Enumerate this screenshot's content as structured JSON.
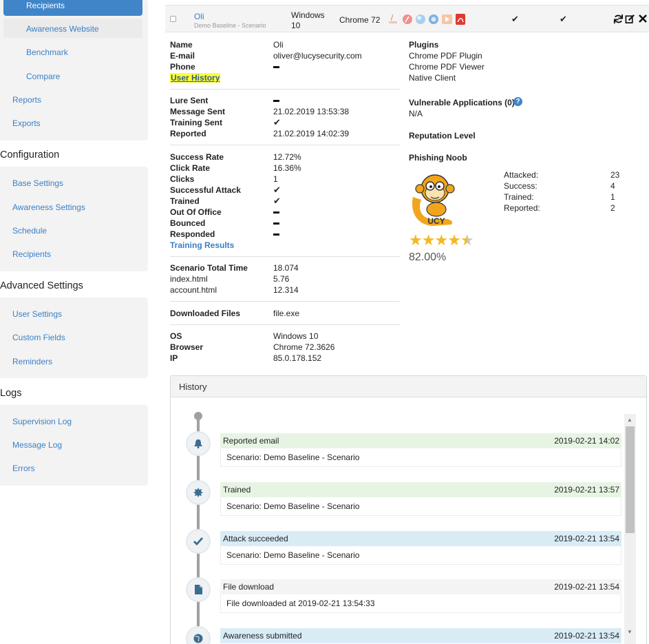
{
  "sidebar": {
    "top_items": [
      {
        "label": "Recipients"
      },
      {
        "label": "Awareness Website"
      },
      {
        "label": "Benchmark"
      },
      {
        "label": "Compare"
      },
      {
        "label": "Reports"
      },
      {
        "label": "Exports"
      }
    ],
    "config_heading": "Configuration",
    "config_items": [
      "Base Settings",
      "Awareness Settings",
      "Schedule",
      "Recipients"
    ],
    "advanced_heading": "Advanced Settings",
    "advanced_items": [
      "User Settings",
      "Custom Fields",
      "Reminders"
    ],
    "logs_heading": "Logs",
    "logs_items": [
      "Supervision Log",
      "Message Log",
      "Errors"
    ]
  },
  "recipient": {
    "name": "Oli",
    "scenario": "Demo Baseline - Scenario",
    "os_line1": "Windows",
    "os_line2": "10",
    "browser": "Chrome 72",
    "check1": "✔",
    "check2": "✔"
  },
  "details": {
    "name_label": "Name",
    "name_value": "Oli",
    "email_label": "E-mail",
    "email_value": "oliver@lucysecurity.com",
    "phone_label": "Phone",
    "user_history_link": "User History",
    "lure_sent_label": "Lure Sent",
    "message_sent_label": "Message Sent",
    "message_sent_value": "21.02.2019 13:53:38",
    "training_sent_label": "Training Sent",
    "training_sent_value": "✔",
    "reported_label": "Reported",
    "reported_value": "21.02.2019 14:02:39",
    "success_rate_label": "Success Rate",
    "success_rate_value": "12.72%",
    "click_rate_label": "Click Rate",
    "click_rate_value": "16.36%",
    "clicks_label": "Clicks",
    "clicks_value": "1",
    "successful_attack_label": "Successful Attack",
    "successful_attack_value": "✔",
    "trained_label": "Trained",
    "trained_value": "✔",
    "out_of_office_label": "Out Of Office",
    "bounced_label": "Bounced",
    "responded_label": "Responded",
    "training_results_link": "Training Results",
    "scenario_total_time_label": "Scenario Total Time",
    "scenario_total_time_value": "18.074",
    "index_label": "index.html",
    "index_value": "5.76",
    "account_label": "account.html",
    "account_value": "12.314",
    "downloaded_files_label": "Downloaded Files",
    "downloaded_files_value": "file.exe",
    "os_label": "OS",
    "os_value": "Windows 10",
    "browser_label": "Browser",
    "browser_value": "Chrome 72.3626",
    "ip_label": "IP",
    "ip_value": "85.0.178.152"
  },
  "right": {
    "plugins_heading": "Plugins",
    "plugins": [
      "Chrome PDF Plugin",
      "Chrome PDF Viewer",
      "Native Client"
    ],
    "vuln_heading": "Vulnerable Applications (0)",
    "vuln_value": "N/A",
    "reputation_heading": "Reputation Level",
    "level_name": "Phishing Noob",
    "stats": [
      {
        "label": "Attacked:",
        "value": "23"
      },
      {
        "label": "Success:",
        "value": "4"
      },
      {
        "label": "Trained:",
        "value": "1"
      },
      {
        "label": "Reported:",
        "value": "2"
      }
    ],
    "rating": 4.5,
    "score": "82.00%"
  },
  "history": {
    "title": "History",
    "events": [
      {
        "title": "Reported email",
        "time": "2019-02-21 14:02",
        "body": "Scenario: Demo Baseline - Scenario",
        "icon": "bell-icon",
        "color": "green"
      },
      {
        "title": "Trained",
        "time": "2019-02-21 13:57",
        "body": "Scenario: Demo Baseline - Scenario",
        "icon": "badge-icon",
        "color": "green"
      },
      {
        "title": "Attack succeeded",
        "time": "2019-02-21 13:54",
        "body": "Scenario: Demo Baseline - Scenario",
        "icon": "check-icon",
        "color": "blue"
      },
      {
        "title": "File download",
        "time": "2019-02-21 13:54",
        "body": "File downloaded at 2019-02-21 13:54:33",
        "icon": "file-icon",
        "color": "grey"
      },
      {
        "title": "Awareness submitted",
        "time": "2019-02-21 13:54",
        "body": "",
        "icon": "globe-icon",
        "color": "blue"
      }
    ]
  },
  "colors": {
    "accent": "#3f85c8",
    "link": "#3a7fc4",
    "highlight": "#ffff33",
    "star": "#f2b824"
  }
}
